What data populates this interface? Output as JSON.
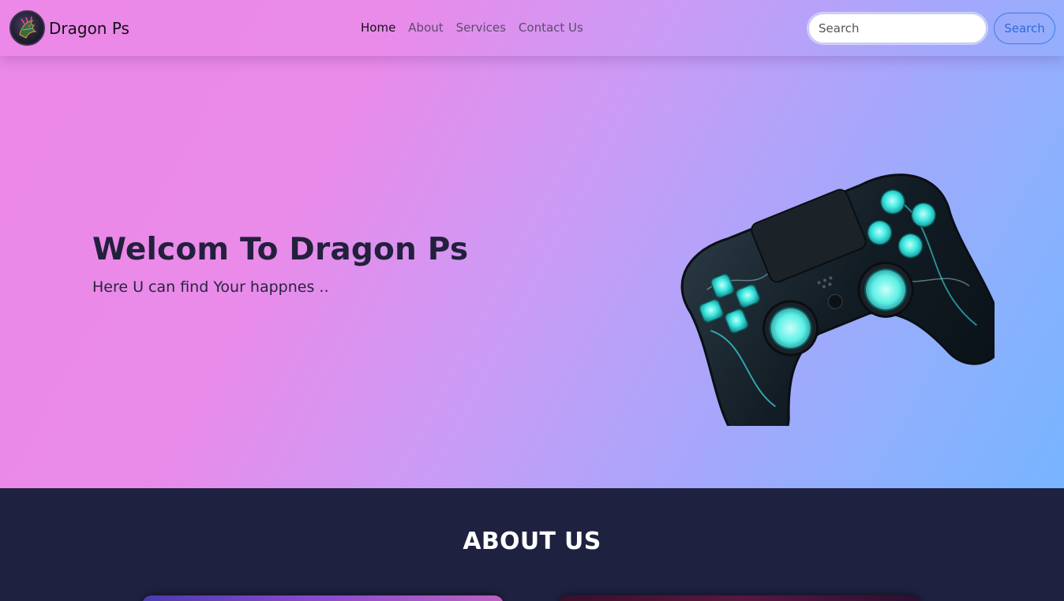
{
  "navbar": {
    "brand": "Dragon Ps",
    "links": [
      {
        "label": "Home",
        "active": true
      },
      {
        "label": "About",
        "active": false
      },
      {
        "label": "Services",
        "active": false
      },
      {
        "label": "Contact Us",
        "active": false
      }
    ],
    "search": {
      "placeholder": "Search",
      "value": ""
    },
    "search_button": "Search"
  },
  "hero": {
    "title": "Welcom To Dragon Ps",
    "subtitle": "Here U can find Your happnes .."
  },
  "about": {
    "title": "ABOUT US"
  },
  "colors": {
    "gradient_start": "#ec88e8",
    "gradient_end": "#77b4ff",
    "dark_section": "#1e2140",
    "accent_blue": "#2f6ad8",
    "controller_glow": "#3ee8e0"
  }
}
